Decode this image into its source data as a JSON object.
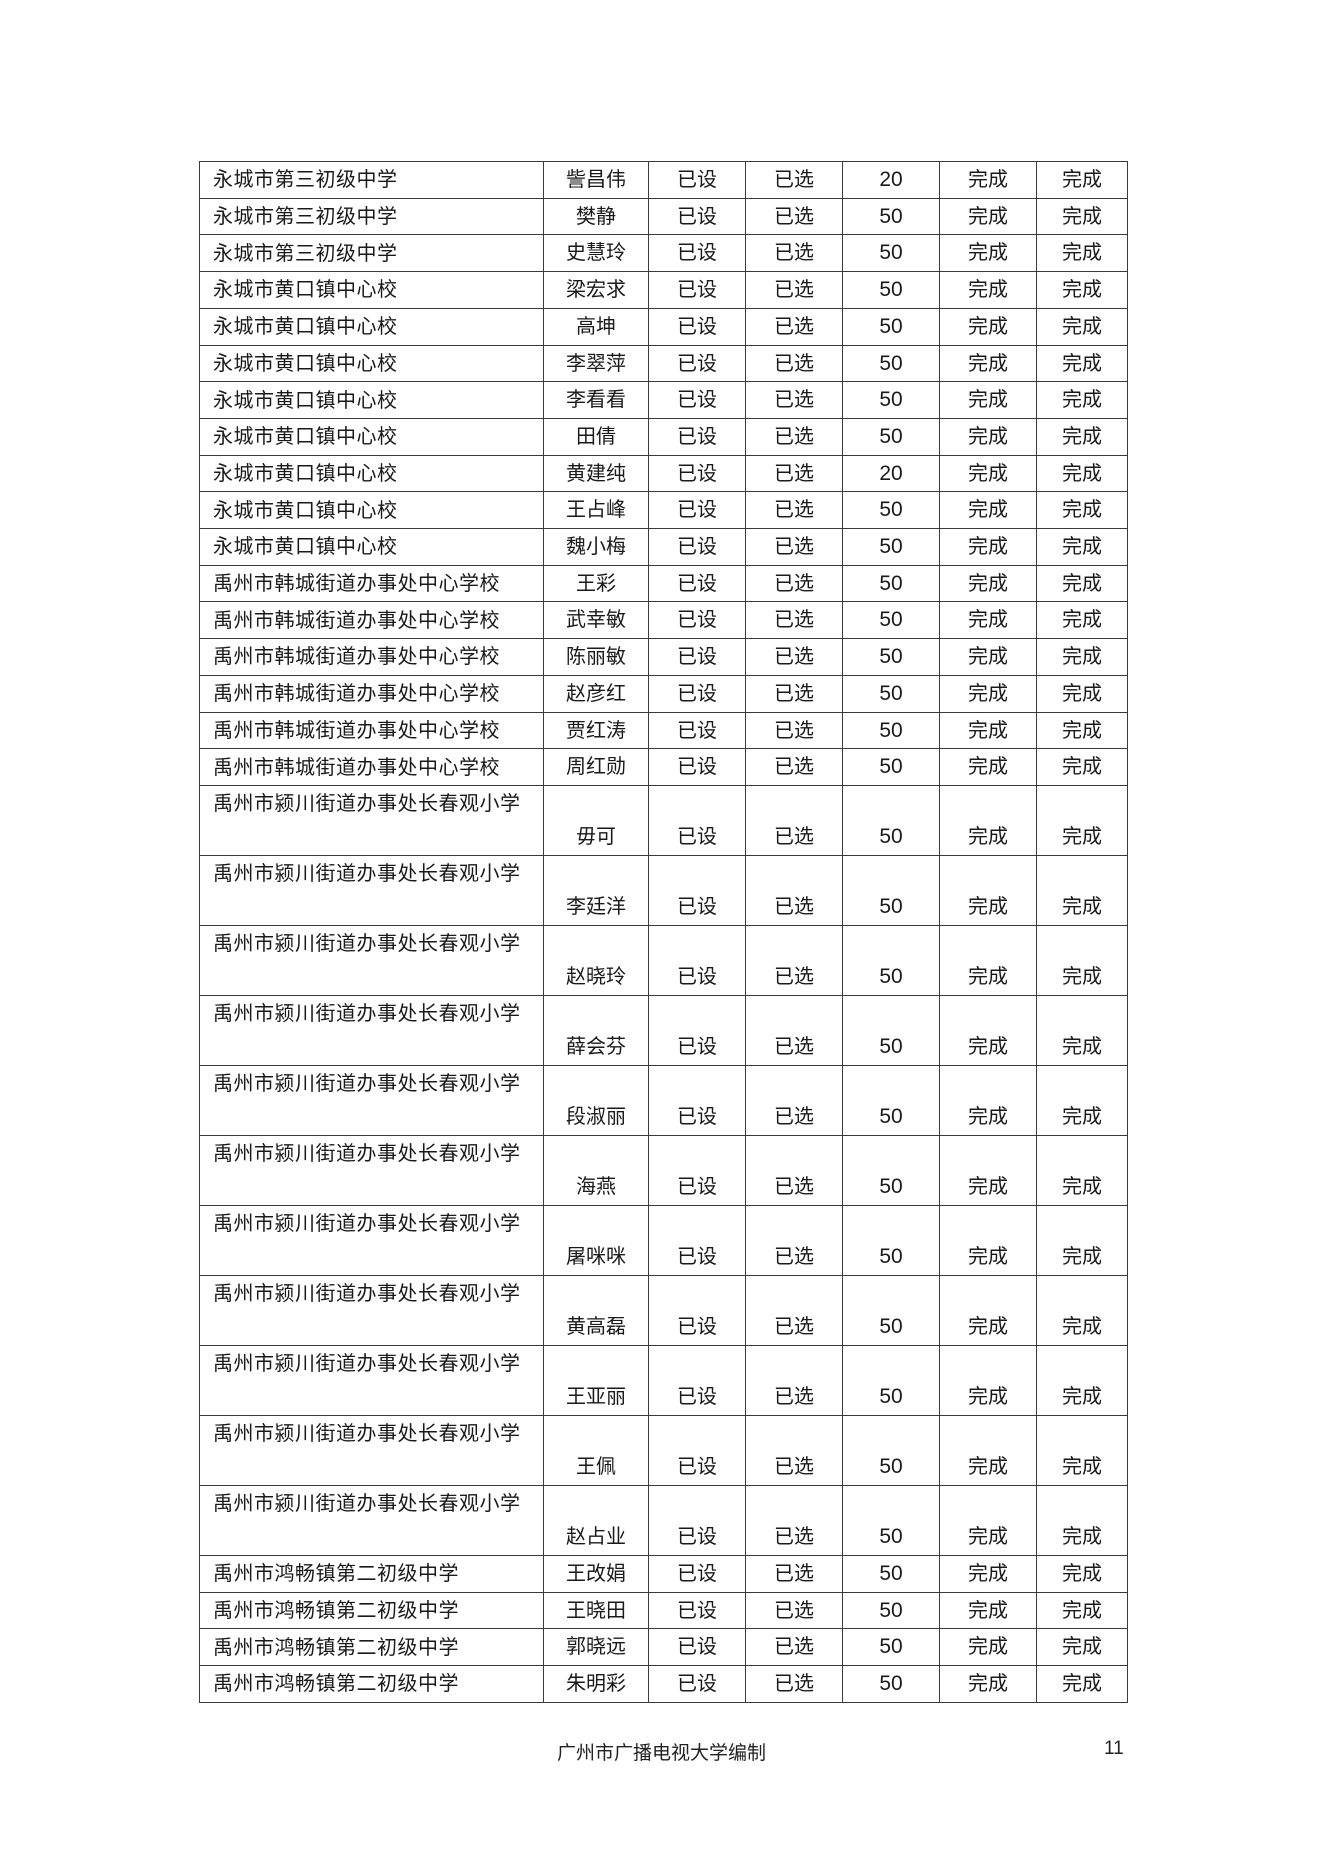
{
  "table": {
    "rows": [
      {
        "school": "永城市第三初级中学",
        "name": "訾昌伟",
        "set": "已设",
        "selected": "已选",
        "credits": "20",
        "status1": "完成",
        "status2": "完成",
        "wrap": false
      },
      {
        "school": "永城市第三初级中学",
        "name": "樊静",
        "set": "已设",
        "selected": "已选",
        "credits": "50",
        "status1": "完成",
        "status2": "完成",
        "wrap": false
      },
      {
        "school": "永城市第三初级中学",
        "name": "史慧玲",
        "set": "已设",
        "selected": "已选",
        "credits": "50",
        "status1": "完成",
        "status2": "完成",
        "wrap": false
      },
      {
        "school": "永城市黄口镇中心校",
        "name": "梁宏求",
        "set": "已设",
        "selected": "已选",
        "credits": "50",
        "status1": "完成",
        "status2": "完成",
        "wrap": false
      },
      {
        "school": "永城市黄口镇中心校",
        "name": "高坤",
        "set": "已设",
        "selected": "已选",
        "credits": "50",
        "status1": "完成",
        "status2": "完成",
        "wrap": false
      },
      {
        "school": "永城市黄口镇中心校",
        "name": "李翠萍",
        "set": "已设",
        "selected": "已选",
        "credits": "50",
        "status1": "完成",
        "status2": "完成",
        "wrap": false
      },
      {
        "school": "永城市黄口镇中心校",
        "name": "李看看",
        "set": "已设",
        "selected": "已选",
        "credits": "50",
        "status1": "完成",
        "status2": "完成",
        "wrap": false
      },
      {
        "school": "永城市黄口镇中心校",
        "name": "田倩",
        "set": "已设",
        "selected": "已选",
        "credits": "50",
        "status1": "完成",
        "status2": "完成",
        "wrap": false
      },
      {
        "school": "永城市黄口镇中心校",
        "name": "黄建纯",
        "set": "已设",
        "selected": "已选",
        "credits": "20",
        "status1": "完成",
        "status2": "完成",
        "wrap": false
      },
      {
        "school": "永城市黄口镇中心校",
        "name": "王占峰",
        "set": "已设",
        "selected": "已选",
        "credits": "50",
        "status1": "完成",
        "status2": "完成",
        "wrap": false
      },
      {
        "school": "永城市黄口镇中心校",
        "name": "魏小梅",
        "set": "已设",
        "selected": "已选",
        "credits": "50",
        "status1": "完成",
        "status2": "完成",
        "wrap": false
      },
      {
        "school": "禹州市韩城街道办事处中心学校",
        "name": "王彩",
        "set": "已设",
        "selected": "已选",
        "credits": "50",
        "status1": "完成",
        "status2": "完成",
        "wrap": false
      },
      {
        "school": "禹州市韩城街道办事处中心学校",
        "name": "武幸敏",
        "set": "已设",
        "selected": "已选",
        "credits": "50",
        "status1": "完成",
        "status2": "完成",
        "wrap": false
      },
      {
        "school": "禹州市韩城街道办事处中心学校",
        "name": "陈丽敏",
        "set": "已设",
        "selected": "已选",
        "credits": "50",
        "status1": "完成",
        "status2": "完成",
        "wrap": false
      },
      {
        "school": "禹州市韩城街道办事处中心学校",
        "name": "赵彦红",
        "set": "已设",
        "selected": "已选",
        "credits": "50",
        "status1": "完成",
        "status2": "完成",
        "wrap": false
      },
      {
        "school": "禹州市韩城街道办事处中心学校",
        "name": "贾红涛",
        "set": "已设",
        "selected": "已选",
        "credits": "50",
        "status1": "完成",
        "status2": "完成",
        "wrap": false
      },
      {
        "school": "禹州市韩城街道办事处中心学校",
        "name": "周红勋",
        "set": "已设",
        "selected": "已选",
        "credits": "50",
        "status1": "完成",
        "status2": "完成",
        "wrap": false
      },
      {
        "school": "禹州市颍川街道办事处长春观小学",
        "name": "毋可",
        "set": "已设",
        "selected": "已选",
        "credits": "50",
        "status1": "完成",
        "status2": "完成",
        "wrap": true
      },
      {
        "school": "禹州市颍川街道办事处长春观小学",
        "name": "李廷洋",
        "set": "已设",
        "selected": "已选",
        "credits": "50",
        "status1": "完成",
        "status2": "完成",
        "wrap": true
      },
      {
        "school": "禹州市颍川街道办事处长春观小学",
        "name": "赵晓玲",
        "set": "已设",
        "selected": "已选",
        "credits": "50",
        "status1": "完成",
        "status2": "完成",
        "wrap": true
      },
      {
        "school": "禹州市颍川街道办事处长春观小学",
        "name": "薛会芬",
        "set": "已设",
        "selected": "已选",
        "credits": "50",
        "status1": "完成",
        "status2": "完成",
        "wrap": true
      },
      {
        "school": "禹州市颍川街道办事处长春观小学",
        "name": "段淑丽",
        "set": "已设",
        "selected": "已选",
        "credits": "50",
        "status1": "完成",
        "status2": "完成",
        "wrap": true
      },
      {
        "school": "禹州市颍川街道办事处长春观小学",
        "name": "海燕",
        "set": "已设",
        "selected": "已选",
        "credits": "50",
        "status1": "完成",
        "status2": "完成",
        "wrap": true
      },
      {
        "school": "禹州市颍川街道办事处长春观小学",
        "name": "屠咪咪",
        "set": "已设",
        "selected": "已选",
        "credits": "50",
        "status1": "完成",
        "status2": "完成",
        "wrap": true
      },
      {
        "school": "禹州市颍川街道办事处长春观小学",
        "name": "黄高磊",
        "set": "已设",
        "selected": "已选",
        "credits": "50",
        "status1": "完成",
        "status2": "完成",
        "wrap": true
      },
      {
        "school": "禹州市颍川街道办事处长春观小学",
        "name": "王亚丽",
        "set": "已设",
        "selected": "已选",
        "credits": "50",
        "status1": "完成",
        "status2": "完成",
        "wrap": true
      },
      {
        "school": "禹州市颍川街道办事处长春观小学",
        "name": "王佩",
        "set": "已设",
        "selected": "已选",
        "credits": "50",
        "status1": "完成",
        "status2": "完成",
        "wrap": true
      },
      {
        "school": "禹州市颍川街道办事处长春观小学",
        "name": "赵占业",
        "set": "已设",
        "selected": "已选",
        "credits": "50",
        "status1": "完成",
        "status2": "完成",
        "wrap": true
      },
      {
        "school": "禹州市鸿畅镇第二初级中学",
        "name": "王改娟",
        "set": "已设",
        "selected": "已选",
        "credits": "50",
        "status1": "完成",
        "status2": "完成",
        "wrap": false
      },
      {
        "school": "禹州市鸿畅镇第二初级中学",
        "name": "王晓田",
        "set": "已设",
        "selected": "已选",
        "credits": "50",
        "status1": "完成",
        "status2": "完成",
        "wrap": false
      },
      {
        "school": "禹州市鸿畅镇第二初级中学",
        "name": "郭晓远",
        "set": "已设",
        "selected": "已选",
        "credits": "50",
        "status1": "完成",
        "status2": "完成",
        "wrap": false
      },
      {
        "school": "禹州市鸿畅镇第二初级中学",
        "name": "朱明彩",
        "set": "已设",
        "selected": "已选",
        "credits": "50",
        "status1": "完成",
        "status2": "完成",
        "wrap": false
      }
    ]
  },
  "footer": {
    "publisher": "广州市广播电视大学编制",
    "page_number": "11"
  }
}
